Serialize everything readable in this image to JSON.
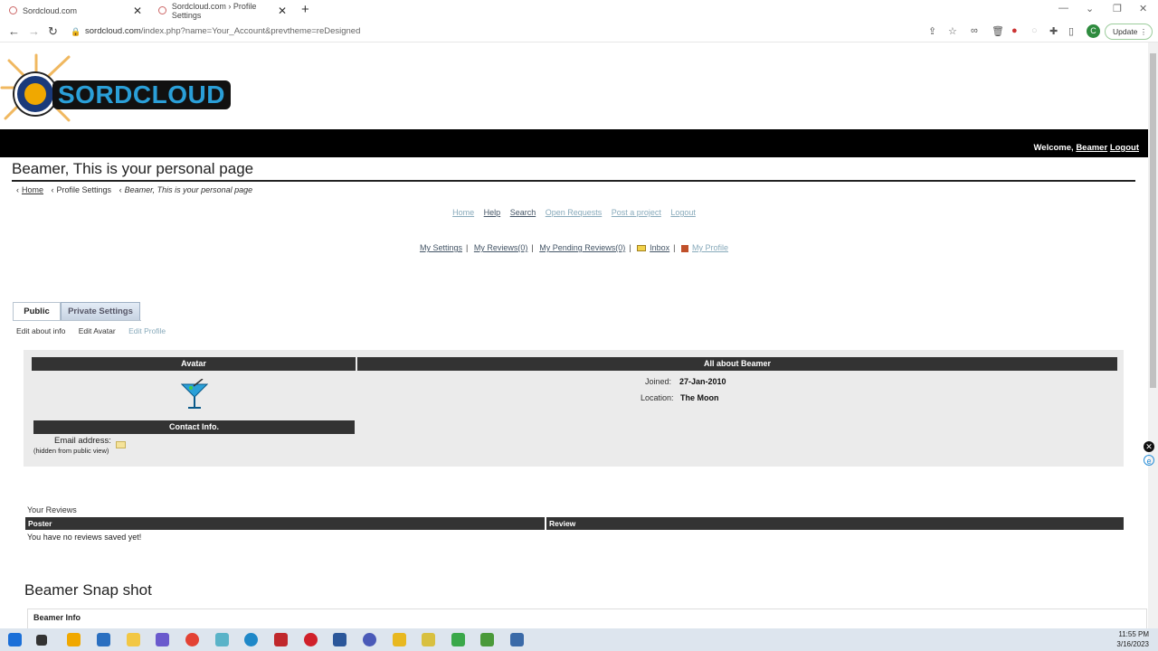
{
  "browser": {
    "tabs": [
      {
        "title": "Sordcloud.com",
        "active": true
      },
      {
        "title": "Sordcloud.com › Profile Settings",
        "active": false
      }
    ],
    "url_host": "sordcloud.com",
    "url_path": "/index.php?name=Your_Account&prevtheme=reDesigned",
    "update_label": "Update",
    "profile_initial": "C"
  },
  "site": {
    "logo_text": "SORDCLOUD",
    "welcome_prefix": "Welcome,",
    "user_name": "Beamer",
    "logout_label": "Logout"
  },
  "page": {
    "title": "Beamer, This is your personal page",
    "breadcrumbs": [
      "Home",
      "Profile Settings",
      "Beamer, This is your personal page"
    ]
  },
  "topnav": [
    "Home",
    "Help",
    "Search",
    "Open Requests",
    "Post a project",
    "Logout"
  ],
  "subnav": [
    "My Settings",
    "My Reviews(0)",
    "My Pending Reviews(0)",
    "Inbox",
    "My Profile"
  ],
  "tabs": {
    "public": "Public",
    "private": "Private Settings",
    "subtabs": [
      "Edit about info",
      "Edit Avatar",
      "Edit Profile"
    ]
  },
  "profile": {
    "avatar_header": "Avatar",
    "about_header": "All about Beamer",
    "contact_header": "Contact Info.",
    "email_label": "Email address:",
    "email_note": "(hidden from public view)",
    "joined_label": "Joined:",
    "joined_value": "27-Jan-2010",
    "location_label": "Location:",
    "location_value": "The Moon"
  },
  "reviews": {
    "title": "Your Reviews",
    "columns": [
      "Poster",
      "Review"
    ],
    "empty": "You have no reviews saved yet!"
  },
  "snapshot": {
    "title": "Beamer Snap shot",
    "section": "Beamer Info"
  },
  "taskbar": {
    "time": "11:55 PM",
    "date": "3/16/2023"
  }
}
